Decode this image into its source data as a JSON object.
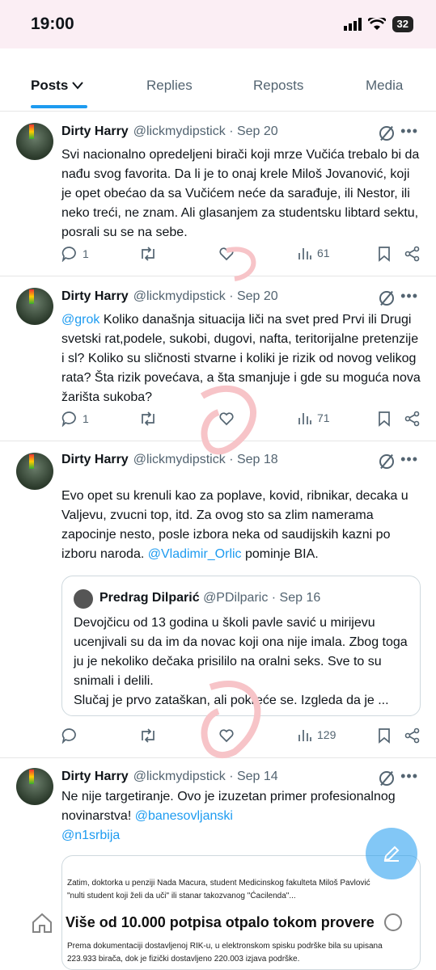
{
  "status_bar": {
    "time": "19:00",
    "battery": "32"
  },
  "tabs": [
    "Posts",
    "Replies",
    "Reposts",
    "Media"
  ],
  "posts": [
    {
      "name": "Dirty Harry",
      "handle": "@lickmydipstick",
      "date": "· Sep 20",
      "text": "Svi nacionalno opredeljeni birači koji mrze Vučića trebalo bi da nađu svog favorita. Da li je to onaj krele Miloš Jovanović, koji je opet obećao da sa Vučićem neće da sarađuje, ili Nestor, ili neko treći, ne znam. Ali glasanjem za studentsku libtard sektu, posrali su se na sebe.",
      "replies": "1",
      "views": "61"
    },
    {
      "name": "Dirty Harry",
      "handle": "@lickmydipstick",
      "date": "· Sep 20",
      "mention": "@grok",
      "text": " Koliko današnja situacija liči na svet pred Prvi ili Drugi svetski rat,podele, sukobi, dugovi, nafta, teritorijalne pretenzije i sl? Koliko su sličnosti stvarne i koliki je rizik od novog velikog rata? Šta rizik povećava, a šta smanjuje i gde su moguća nova žarišta sukoba?",
      "replies": "1",
      "views": "71"
    },
    {
      "name": "Dirty Harry",
      "handle": "@lickmydipstick",
      "date": "· Sep 18",
      "text": "Evo opet su krenuli kao za poplave, kovid, ribnikar, decaka u Valjevu, zvucni top, itd. Za ovog sto sa zlim namerama zapocinje nesto, posle izbora neka od saudijskih kazni po izboru naroda. ",
      "mention": "@Vladimir_Orlic",
      "text_after": " pominje BIA.",
      "quote": {
        "name": "Predrag Dilparić",
        "handle": "@PDilparic",
        "date": "· Sep 16",
        "text": "Devojčicu od 13 godina u školi pavle savić u mirijevu ucenjivali su da im da novac koji ona nije imala. Zbog toga ju je nekoliko dečaka prisililo na oralni seks. Sve to su snimali i delili.\nSlučaj je prvo zataškan, ali pokreće se. Izgleda da je ..."
      },
      "views": "129"
    },
    {
      "name": "Dirty Harry",
      "handle": "@lickmydipstick",
      "date": "· Sep 14",
      "text": "Ne nije targetiranje. Ovo je izuzetan primer profesionalnog novinarstva! ",
      "mention": "@banesovljanski",
      "mention2": "@n1srbija",
      "image": {
        "line1": "Zatim, doktorka u penziji Nada Macura, student Medicinskog fakulteta Miloš Pavlović",
        "line2": "\"nulti student koji želi da uči\" ili stanar takozvanog \"Ćacilenda\"...",
        "title": "Više od 10.000 potpisa otpalo tokom provere",
        "line3": "Prema dokumentaciji dostavljenoj RIK-u, u elektronskom spisku podrške bila su upisana",
        "line4": "223.933 birača, dok je fizički dostavljeno 220.003 izjava podrške."
      }
    }
  ],
  "colors": {
    "accent": "#1d9bf0",
    "text": "#0f1419",
    "muted": "#536471",
    "statusbar": "#fbeef4"
  }
}
